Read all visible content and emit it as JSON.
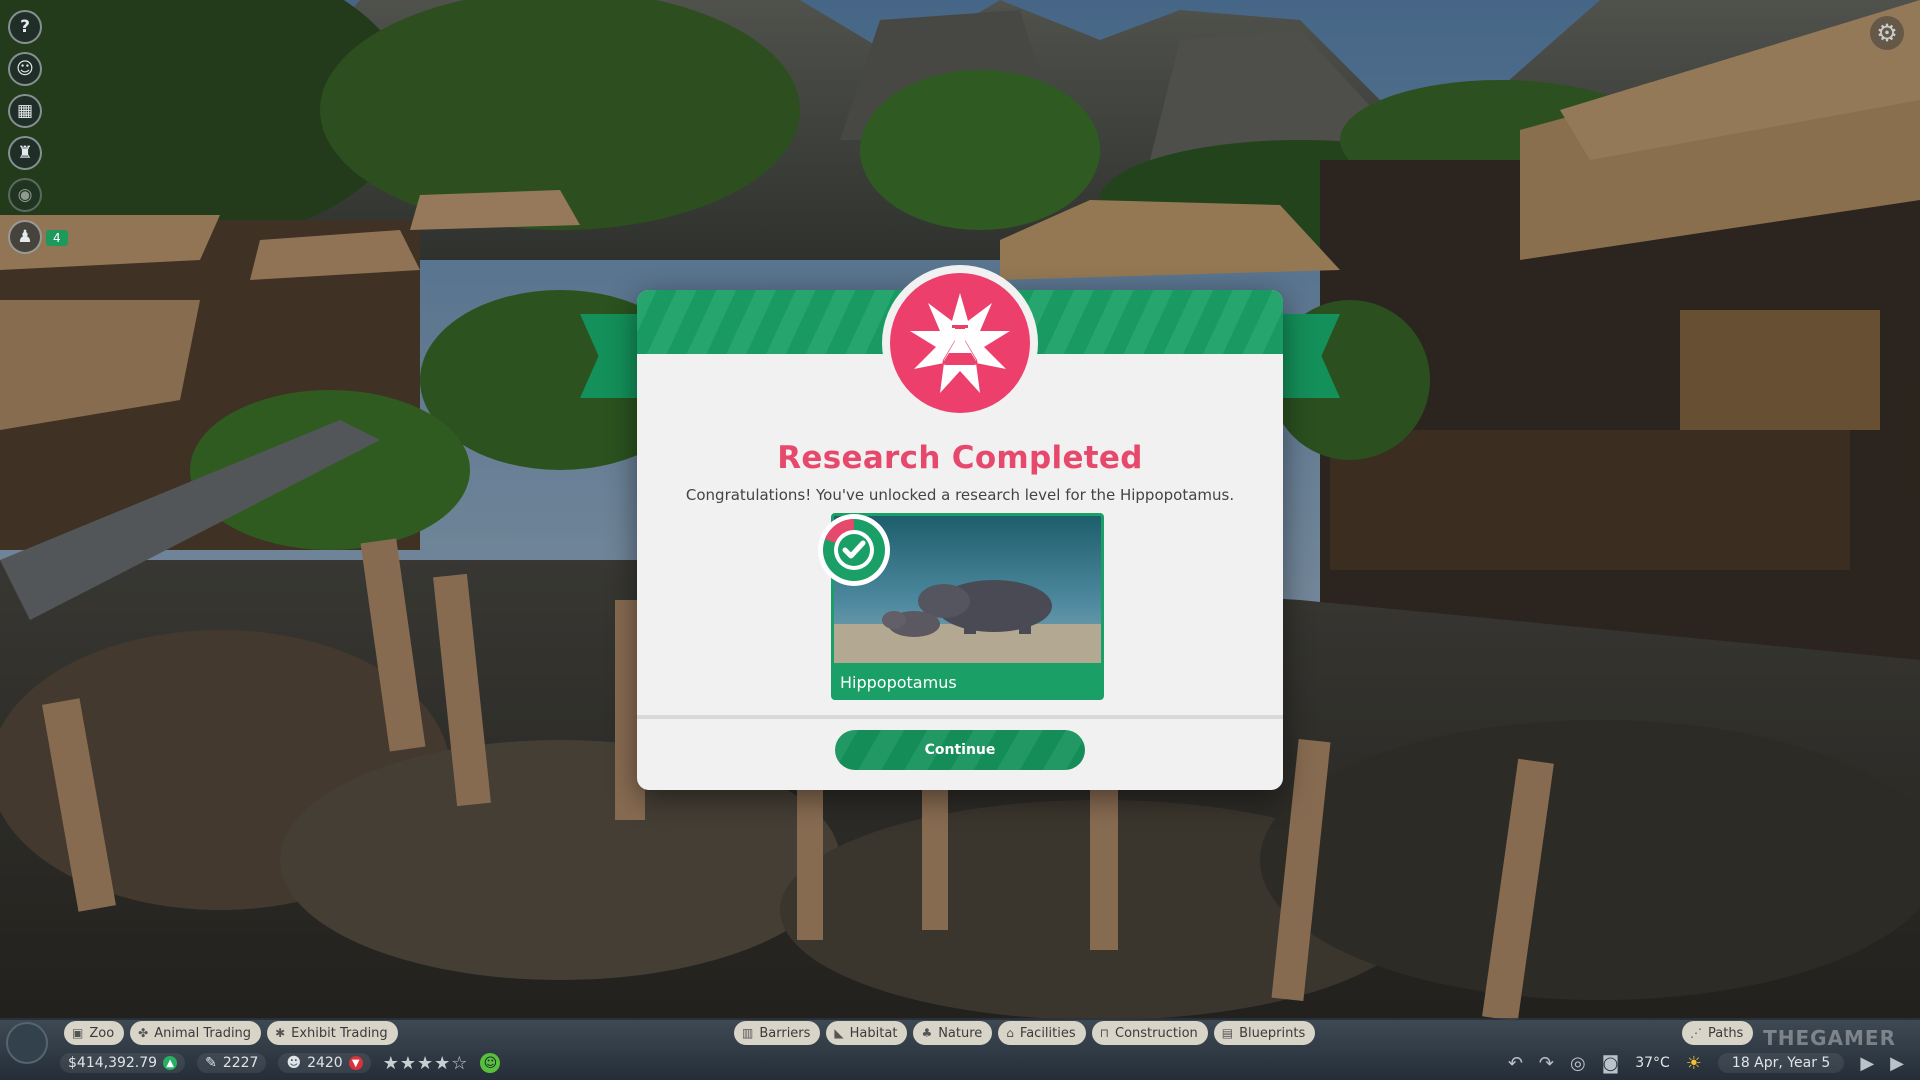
{
  "side_toolbar": {
    "alert_count": "4"
  },
  "dialog": {
    "title": "Research Completed",
    "message": "Congratulations! You've unlocked a research level for the Hippopotamus.",
    "animal_name": "Hippopotamus",
    "continue_label": "Continue"
  },
  "tabs_left": [
    "Zoo",
    "Animal Trading",
    "Exhibit Trading"
  ],
  "tabs_center": [
    "Barriers",
    "Habitat",
    "Nature",
    "Facilities",
    "Construction",
    "Blueprints"
  ],
  "tabs_right": [
    "Paths"
  ],
  "status": {
    "money": "$414,392.79",
    "research_points": "2227",
    "guests": "2420",
    "rating_stars": 4,
    "temperature": "37°C",
    "date": "18 Apr, Year 5"
  },
  "watermark": "THEGAMER",
  "colors": {
    "accent_green": "#1aa066",
    "title_pink": "#e6496c",
    "badge_pink": "#ec3f6c"
  }
}
